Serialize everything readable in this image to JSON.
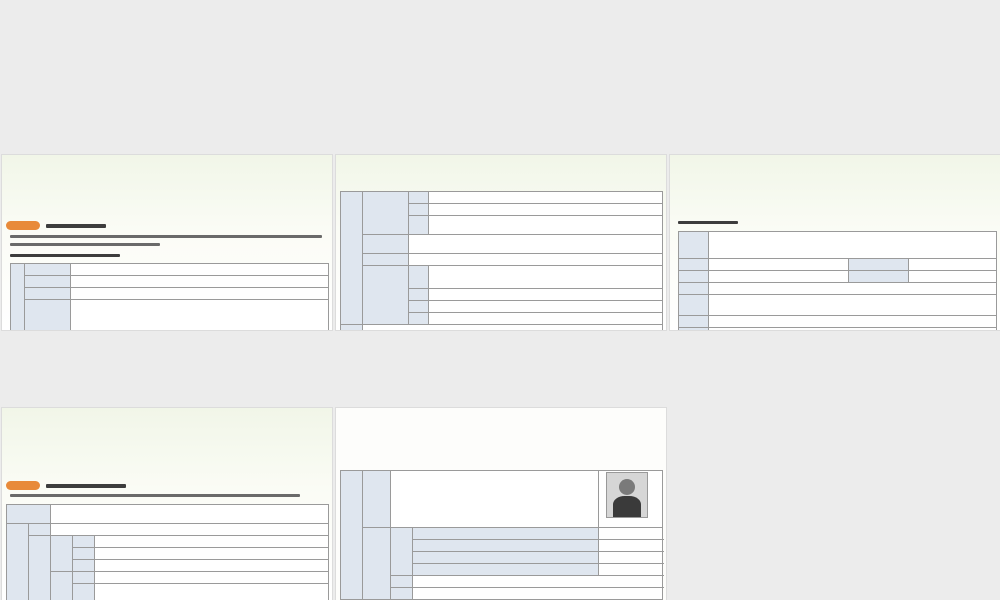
{
  "slides": [
    {
      "id": "slide-1",
      "theme": "green",
      "layout": "revolution-pioneer-table"
    },
    {
      "id": "slide-2",
      "theme": "green",
      "layout": "revolution-activities-table"
    },
    {
      "id": "slide-3",
      "theme": "green",
      "layout": "xinhai-revolution-table"
    },
    {
      "id": "slide-4",
      "theme": "green",
      "layout": "beiyang-government-table"
    },
    {
      "id": "slide-5",
      "theme": "plain",
      "layout": "yuan-shikai-table"
    },
    {
      "id": "slide-6",
      "theme": "blank",
      "layout": "empty"
    }
  ],
  "colors": {
    "accent_tag": "#e88a3a",
    "header_cell": "#dfe6ef",
    "slide_green": "#f1f6e8",
    "background": "#ececec"
  },
  "icons": [
    "portrait-sun-yat-sen-icon",
    "portrait-yuan-shikai-icon"
  ]
}
